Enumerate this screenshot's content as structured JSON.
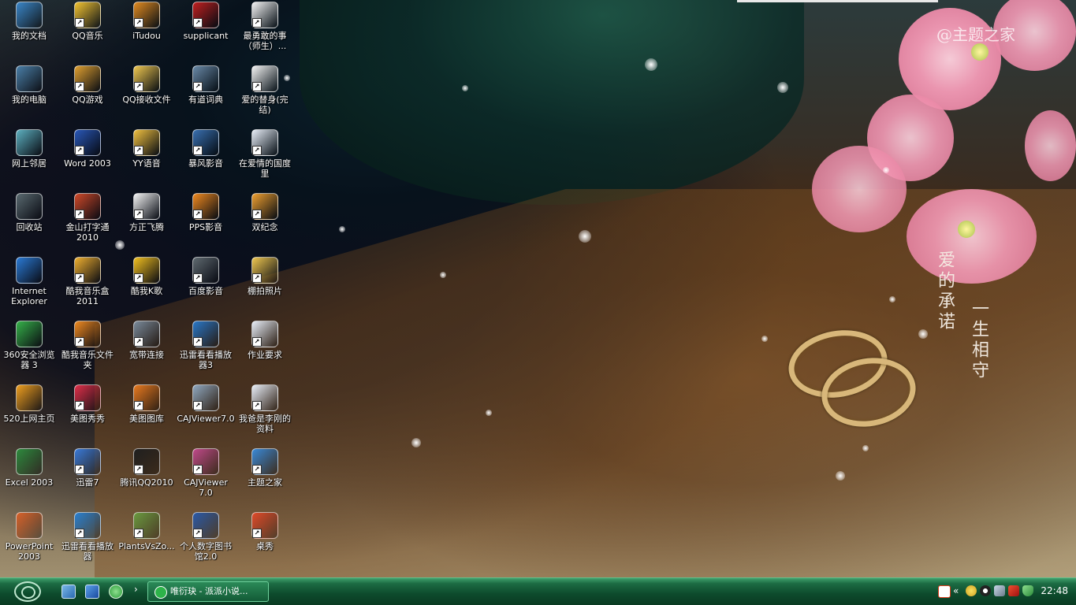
{
  "desktop": {
    "watermark": "@主题之家",
    "calligraphy_1": "爱的承诺",
    "calligraphy_2": "一生相守",
    "icons": [
      {
        "label": "我的文档",
        "icon": "my-documents-icon",
        "color": "#3a86c8"
      },
      {
        "label": "我的电脑",
        "icon": "my-computer-icon",
        "color": "#4a7fa8"
      },
      {
        "label": "网上邻居",
        "icon": "network-places-icon",
        "color": "#5db0c0"
      },
      {
        "label": "回收站",
        "icon": "recycle-bin-icon",
        "color": "#5a6a70"
      },
      {
        "label": "Internet Explorer",
        "icon": "internet-explorer-icon",
        "color": "#2b7bd6"
      },
      {
        "label": "360安全浏览器 3",
        "icon": "360-browser-icon",
        "color": "#36b24a"
      },
      {
        "label": "520上网主页",
        "icon": "520-homepage-icon",
        "color": "#f0a020"
      },
      {
        "label": "Excel 2003",
        "icon": "excel-icon",
        "color": "#2e8b3e"
      },
      {
        "label": "PowerPoint 2003",
        "icon": "powerpoint-icon",
        "color": "#d8622a"
      },
      {
        "label": "QQ音乐",
        "icon": "qq-music-icon",
        "color": "#f2c230"
      },
      {
        "label": "QQ游戏",
        "icon": "qq-game-icon",
        "color": "#e0a030"
      },
      {
        "label": "Word 2003",
        "icon": "word-icon",
        "color": "#2a58b8"
      },
      {
        "label": "金山打字通 2010",
        "icon": "typing-tutor-icon",
        "color": "#d04a2a"
      },
      {
        "label": "酷我音乐盒 2011",
        "icon": "kuwo-music-icon",
        "color": "#f0b030"
      },
      {
        "label": "酷我音乐文件夹",
        "icon": "kuwo-folder-icon",
        "color": "#f08a20"
      },
      {
        "label": "美图秀秀",
        "icon": "meitu-xiuxiu-icon",
        "color": "#e0304a"
      },
      {
        "label": "迅雷7",
        "icon": "thunder-icon",
        "color": "#3a7ad8"
      },
      {
        "label": "迅雷看看播放器",
        "icon": "thunder-player-icon",
        "color": "#2a80d0"
      },
      {
        "label": "iTudou",
        "icon": "itudou-icon",
        "color": "#e08a20"
      },
      {
        "label": "QQ接收文件",
        "icon": "folder-icon",
        "color": "#f0c850"
      },
      {
        "label": "YY语音",
        "icon": "yy-voice-icon",
        "color": "#f0c040"
      },
      {
        "label": "方正飞腾",
        "icon": "founder-icon",
        "color": "#f4f4f4"
      },
      {
        "label": "酷我K歌",
        "icon": "kuwo-karaoke-icon",
        "color": "#f2c020"
      },
      {
        "label": "宽带连接",
        "icon": "broadband-icon",
        "color": "#7a8a9a"
      },
      {
        "label": "美图图库",
        "icon": "meitu-gallery-icon",
        "color": "#e87a20"
      },
      {
        "label": "腾讯QQ2010",
        "icon": "qq-icon",
        "color": "#202020"
      },
      {
        "label": "PlantsVsZo...",
        "icon": "plants-vs-zombies-icon",
        "color": "#6a9a40"
      },
      {
        "label": "supplicant",
        "icon": "supplicant-icon",
        "color": "#c02020"
      },
      {
        "label": "有道词典",
        "icon": "youdao-dict-icon",
        "color": "#6a8aa8"
      },
      {
        "label": "暴风影音",
        "icon": "storm-player-icon",
        "color": "#3a70b0"
      },
      {
        "label": "PPS影音",
        "icon": "pps-player-icon",
        "color": "#f08a20"
      },
      {
        "label": "百度影音",
        "icon": "baidu-player-icon",
        "color": "#606a70"
      },
      {
        "label": "迅雷看看播放器3",
        "icon": "thunder-player3-icon",
        "color": "#2a78c8"
      },
      {
        "label": "CAJViewer7.0",
        "icon": "cajviewer-icon",
        "color": "#90a8c0"
      },
      {
        "label": "CAJViewer 7.0",
        "icon": "cajviewer-icon",
        "color": "#c04a8a"
      },
      {
        "label": "个人数字图书馆2.0",
        "icon": "digital-library-icon",
        "color": "#2a5aa8"
      },
      {
        "label": "最勇敢的事（师生）...",
        "icon": "text-document-icon",
        "color": "#f4f4f4"
      },
      {
        "label": "爱的替身(完结)",
        "icon": "text-document-icon",
        "color": "#f4f4f4"
      },
      {
        "label": "在爱情的国度里",
        "icon": "word-document-icon",
        "color": "#e8eef8"
      },
      {
        "label": "双纪念",
        "icon": "image-file-icon",
        "color": "#f0a030"
      },
      {
        "label": "棚拍照片",
        "icon": "folder-icon",
        "color": "#f0c850"
      },
      {
        "label": "作业要求",
        "icon": "word-document-icon",
        "color": "#e8eef8"
      },
      {
        "label": "我爸是李刚的资料",
        "icon": "word-document-icon",
        "color": "#e8eef8"
      },
      {
        "label": "主题之家",
        "icon": "theme-home-icon",
        "color": "#3a8ad8"
      },
      {
        "label": "桌秀",
        "icon": "zhuoxiu-icon",
        "color": "#e04a2a"
      }
    ]
  },
  "taskbar": {
    "task_button_label": "唯衍玦 - 派派小说...",
    "clock": "22:48",
    "quick_launch": [
      "show-desktop-icon",
      "media-player-icon",
      "360-browser-icon"
    ],
    "tray_icons": [
      "sogou-input-icon",
      "tray-arrow-icon",
      "qq-music-tray-icon",
      "qq-tray-icon",
      "network-tray-icon",
      "antivirus-tray-icon",
      "security-shield-icon"
    ]
  }
}
